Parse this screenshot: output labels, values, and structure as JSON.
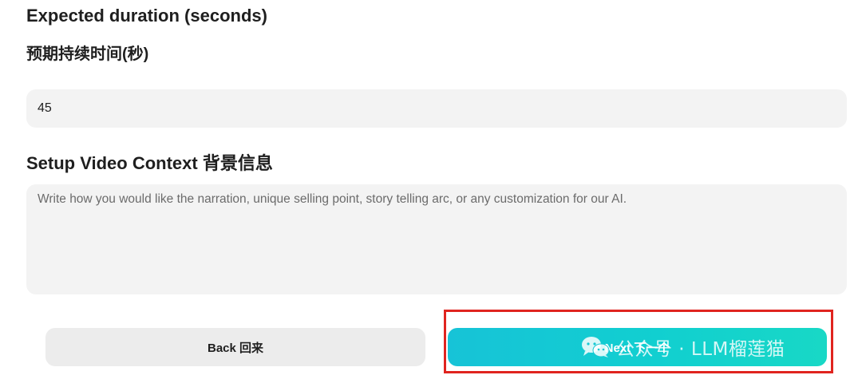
{
  "duration": {
    "label_en": "Expected duration (seconds)",
    "label_zh": "预期持续时间(秒)",
    "value": "45"
  },
  "context": {
    "title": "Setup Video Context 背景信息",
    "placeholder": "Write how you would like the narration, unique selling point, story telling arc, or any customization for our AI."
  },
  "buttons": {
    "back_label": "Back  回来",
    "next_label": "Next  下一个"
  },
  "watermark": {
    "icon": "wechat-icon",
    "text": "公众号 · LLM榴莲猫"
  },
  "colors": {
    "field_background": "#f3f3f3",
    "back_button_background": "#ececec",
    "next_button_gradient_start": "#17c3d7",
    "next_button_gradient_end": "#18d8c6",
    "highlight_border": "#e0241f"
  }
}
